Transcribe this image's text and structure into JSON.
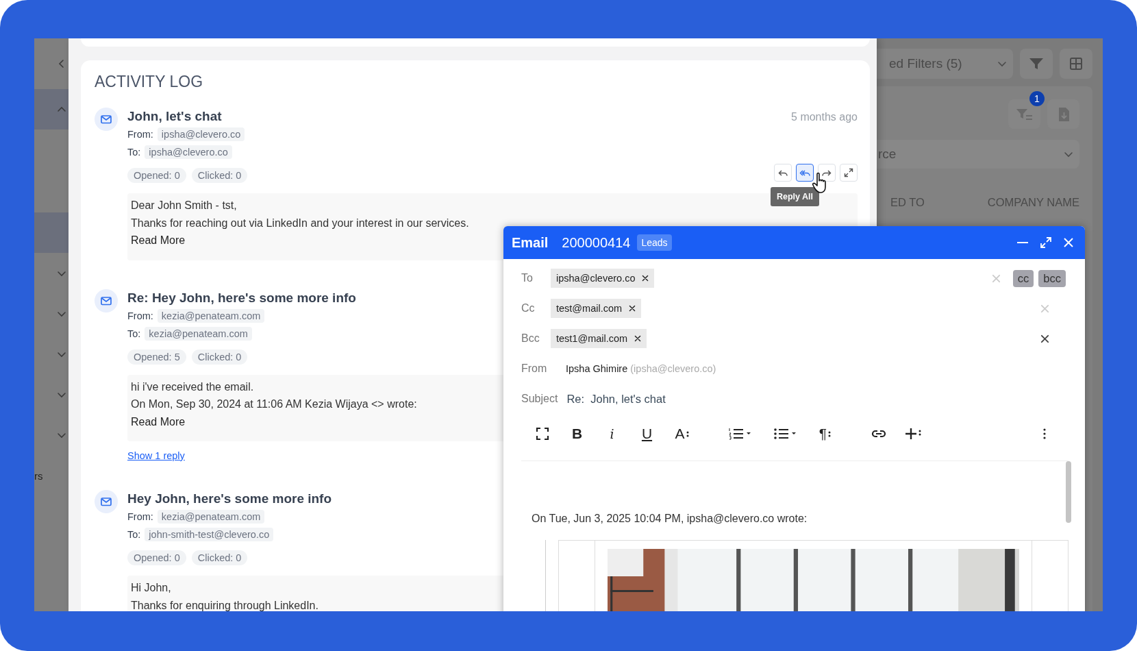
{
  "sidebar": {
    "items": [
      {
        "kind": "group",
        "selected": true,
        "expanded": true
      },
      {
        "kind": "link",
        "selected": true
      },
      {
        "kind": "group",
        "selected": false,
        "expanded": false
      },
      {
        "kind": "group",
        "selected": false,
        "expanded": false
      },
      {
        "kind": "group",
        "selected": false,
        "expanded": false
      },
      {
        "kind": "group",
        "selected": false,
        "expanded": false
      },
      {
        "kind": "group",
        "selected": false,
        "expanded": false
      }
    ],
    "cut_label": "rs"
  },
  "activity_log": {
    "title": "ACTIVITY LOG",
    "entries": [
      {
        "title": "John, let's chat",
        "time": "5 months ago",
        "from_label": "From:",
        "from": "ipsha@clevero.co",
        "to_label": "To:",
        "to": "ipsha@clevero.co",
        "opened": "Opened: 0",
        "clicked": "Clicked: 0",
        "body": [
          "Dear John Smith - tst,",
          "Thanks for reaching out via LinkedIn and your interest in our services."
        ],
        "read_more": "Read More",
        "actions": [
          {
            "kind": "reply",
            "selected": false
          },
          {
            "kind": "reply-all",
            "selected": true
          },
          {
            "kind": "forward",
            "selected": false
          },
          {
            "kind": "expand",
            "selected": false
          }
        ],
        "tooltip": "Reply All"
      },
      {
        "title": "Re: Hey John, here's some more info",
        "from_label": "From:",
        "from": "kezia@penateam.com",
        "to_label": "To:",
        "to": "kezia@penateam.com",
        "opened": "Opened: 5",
        "clicked": "Clicked: 0",
        "body": [
          "hi i've received the email.",
          "On Mon, Sep 30, 2024 at 11:06 AM Kezia Wijaya <> wrote:"
        ],
        "read_more": "Read More",
        "show_replies": "Show 1 reply"
      },
      {
        "title": "Hey John, here's some more info",
        "from_label": "From:",
        "from": "kezia@penateam.com",
        "to_label": "To:",
        "to": "john-smith-test@clevero.co",
        "opened": "Opened: 0",
        "clicked": "Clicked: 0",
        "body": [
          "Hi John,",
          "Thanks for enquiring through LinkedIn."
        ]
      }
    ]
  },
  "background_list": {
    "filter_dropdown": "ed Filters (5)",
    "filter_badge": "1",
    "source_dropdown": "rce",
    "columns": [
      "ED TO",
      "COMPANY NAME"
    ]
  },
  "email_window": {
    "title": "Email",
    "record": "200000414",
    "tag": "Leads",
    "rows": [
      {
        "kind": "recipients",
        "label": "To",
        "chips": [
          "ipsha@clevero.co"
        ],
        "clear_active": false,
        "cc": "cc",
        "bcc": "bcc"
      },
      {
        "kind": "recipients",
        "label": "Cc",
        "chips": [
          "test@mail.com"
        ],
        "clear_active": false
      },
      {
        "kind": "recipients",
        "label": "Bcc",
        "chips": [
          "test1@mail.com"
        ],
        "clear_active": true
      },
      {
        "kind": "from",
        "label": "From",
        "name": "Ipsha Ghimire",
        "address": "(ipsha@clevero.co)"
      },
      {
        "kind": "subject",
        "label": "Subject",
        "value": "Re:  John, let's chat"
      }
    ],
    "toolbar": [
      {
        "kind": "fullscreen"
      },
      {
        "kind": "bold",
        "label": "B"
      },
      {
        "kind": "italic",
        "label": "i"
      },
      {
        "kind": "underline",
        "label": "U"
      },
      {
        "kind": "font-size",
        "label": "A"
      },
      {
        "kind": "numbered-list"
      },
      {
        "kind": "bullet-list"
      },
      {
        "kind": "paragraph",
        "label": "¶"
      },
      {
        "kind": "link"
      },
      {
        "kind": "insert"
      },
      {
        "kind": "more"
      }
    ],
    "quote_header": "On Tue, Jun 3, 2025 10:04 PM, ipsha@clevero.co wrote:"
  }
}
